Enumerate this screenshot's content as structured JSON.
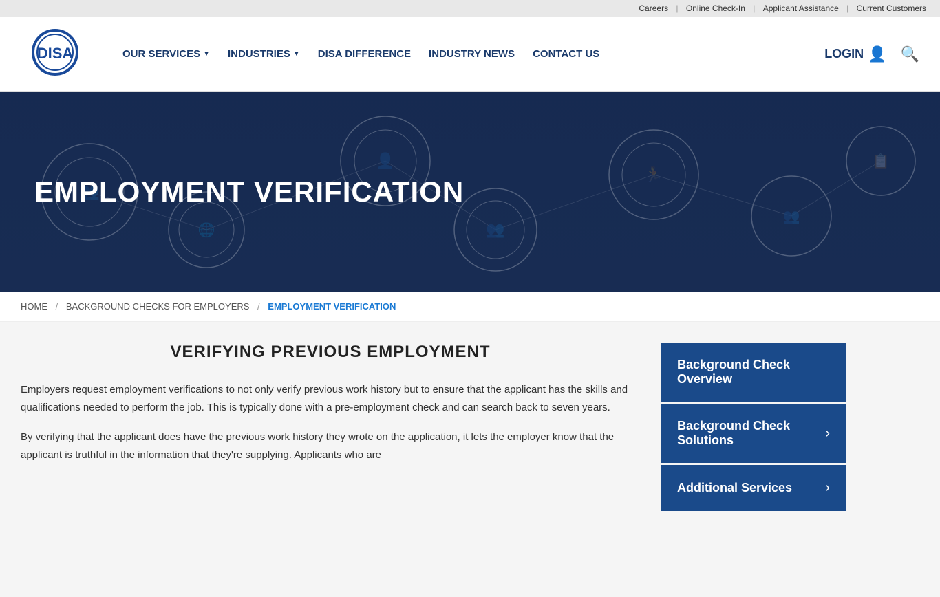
{
  "topbar": {
    "links": [
      {
        "label": "Careers"
      },
      {
        "label": "Online Check-In"
      },
      {
        "label": "Applicant Assistance"
      },
      {
        "label": "Current Customers"
      }
    ]
  },
  "header": {
    "logo_alt": "DISA",
    "nav_items": [
      {
        "label": "OUR SERVICES",
        "has_dropdown": true
      },
      {
        "label": "INDUSTRIES",
        "has_dropdown": true
      },
      {
        "label": "DISA DIFFERENCE",
        "has_dropdown": false
      },
      {
        "label": "INDUSTRY NEWS",
        "has_dropdown": false
      },
      {
        "label": "CONTACT US",
        "has_dropdown": false
      }
    ],
    "login_label": "LOGIN",
    "search_label": "Search"
  },
  "hero": {
    "title": "EMPLOYMENT VERIFICATION"
  },
  "breadcrumb": {
    "home": "HOME",
    "bg_checks": "BACKGROUND CHECKS FOR EMPLOYERS",
    "current": "EMPLOYMENT VERIFICATION"
  },
  "main": {
    "section_title": "VERIFYING PREVIOUS EMPLOYMENT",
    "paragraphs": [
      "Employers request employment verifications to not only verify previous work history but to ensure that the applicant has the skills and qualifications needed to perform the job. This is typically done with a pre-employment check and can search back to seven years.",
      "By verifying that the applicant does have the previous work history they wrote on the application, it lets the employer know that the applicant is truthful in the information that they're supplying. Applicants who are"
    ]
  },
  "sidebar": {
    "items": [
      {
        "label": "Background Check Overview",
        "has_chevron": false
      },
      {
        "label": "Background Check Solutions",
        "has_chevron": true
      },
      {
        "label": "Additional Services",
        "has_chevron": true
      }
    ]
  }
}
